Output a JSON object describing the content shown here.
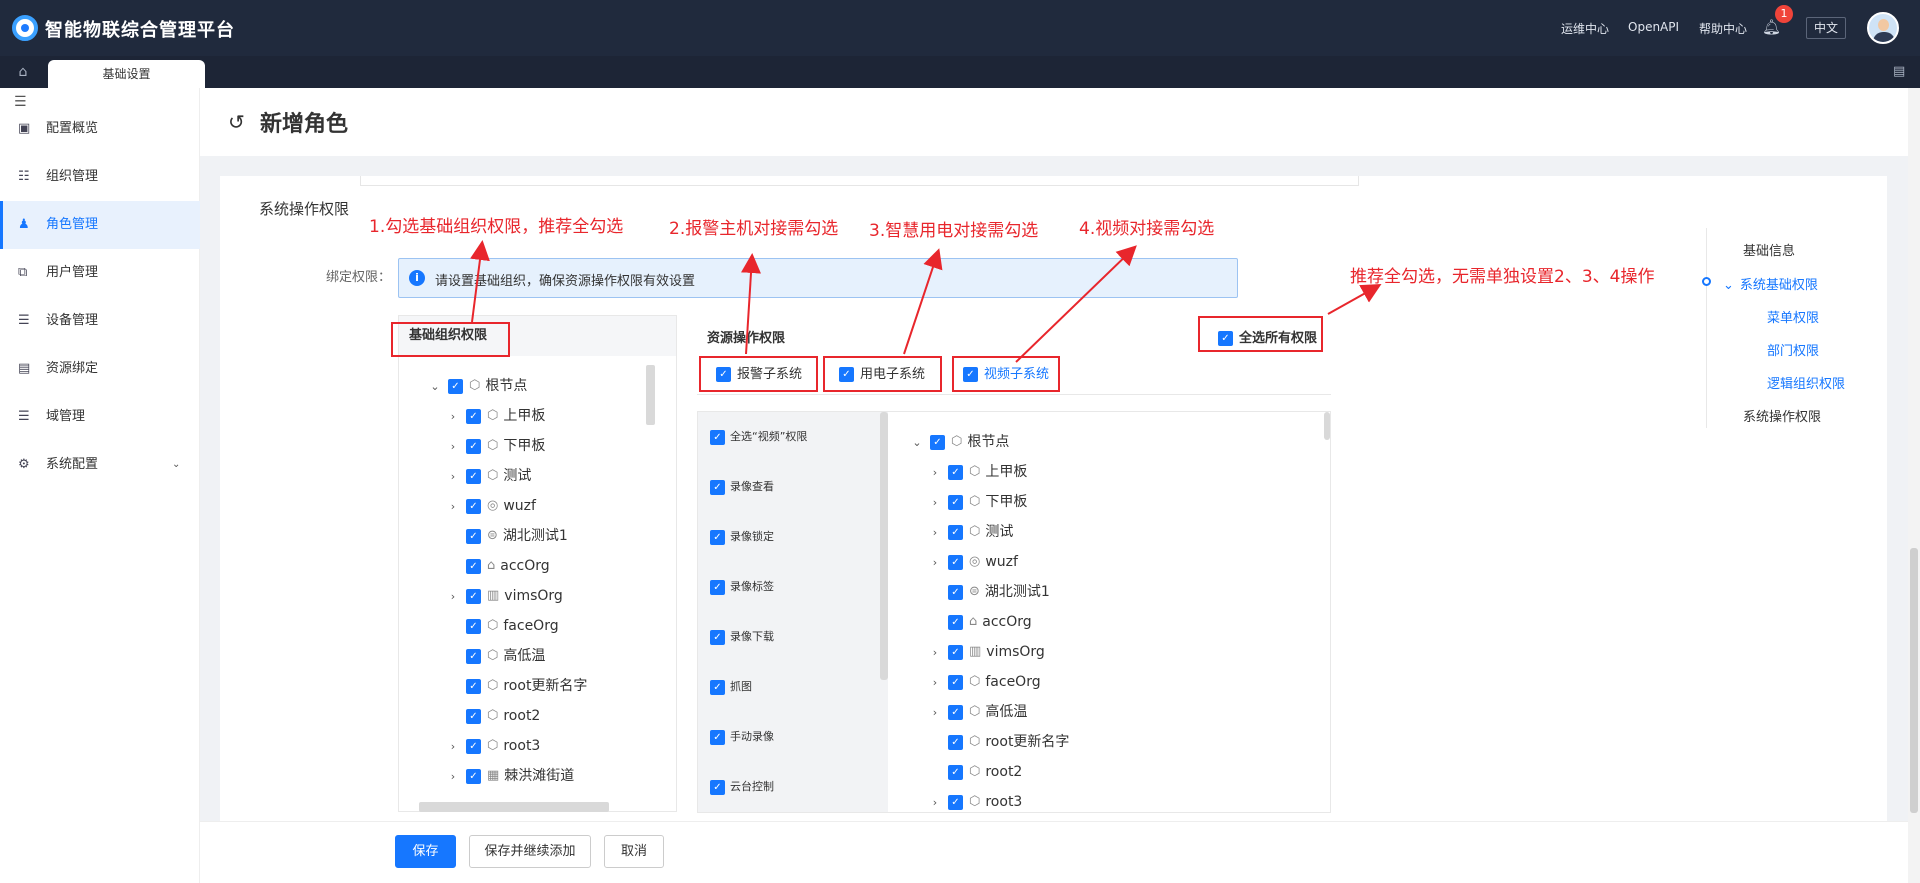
{
  "app": {
    "title": "智能物联综合管理平台"
  },
  "header": {
    "links": [
      "运维中心",
      "OpenAPI",
      "帮助中心"
    ],
    "notification_count": "1",
    "lang": "中文"
  },
  "tabs": {
    "active": "基础设置"
  },
  "sidebar": {
    "items": [
      {
        "label": "配置概览",
        "icon": "dashboard-icon",
        "glyph": "▣"
      },
      {
        "label": "组织管理",
        "icon": "org-icon",
        "glyph": "☷"
      },
      {
        "label": "角色管理",
        "icon": "role-icon",
        "glyph": "♟"
      },
      {
        "label": "用户管理",
        "icon": "user-icon",
        "glyph": "⧉"
      },
      {
        "label": "设备管理",
        "icon": "device-icon",
        "glyph": "☰"
      },
      {
        "label": "资源绑定",
        "icon": "resource-icon",
        "glyph": "▤"
      },
      {
        "label": "域管理",
        "icon": "domain-icon",
        "glyph": "☰"
      },
      {
        "label": "系统配置",
        "icon": "gear-icon",
        "glyph": "⚙"
      }
    ]
  },
  "page": {
    "title": "新增角色"
  },
  "section": {
    "title": "系统操作权限",
    "bind_label": "绑定权限：",
    "alert": "请设置基础组织，确保资源操作权限有效设置"
  },
  "org_panel": {
    "title": "基础组织权限",
    "tree": [
      {
        "label": "根节点",
        "level": 0,
        "expand": "down",
        "icon": "cube-icon"
      },
      {
        "label": "上甲板",
        "level": 1,
        "expand": "right",
        "icon": "cube-icon"
      },
      {
        "label": "下甲板",
        "level": 1,
        "expand": "right",
        "icon": "cube-icon"
      },
      {
        "label": "测试",
        "level": 1,
        "expand": "right",
        "icon": "cube-icon"
      },
      {
        "label": "wuzf",
        "level": 1,
        "expand": "right",
        "icon": "org-circle-icon"
      },
      {
        "label": "湖北测试1",
        "level": 1,
        "expand": "",
        "icon": "bank-icon"
      },
      {
        "label": "accOrg",
        "level": 1,
        "expand": "",
        "icon": "home-icon"
      },
      {
        "label": "vimsOrg",
        "level": 1,
        "expand": "right",
        "icon": "building-icon"
      },
      {
        "label": "faceOrg",
        "level": 1,
        "expand": "",
        "icon": "cube-icon"
      },
      {
        "label": "高低温",
        "level": 1,
        "expand": "",
        "icon": "cube-icon"
      },
      {
        "label": "root更新名字",
        "level": 1,
        "expand": "",
        "icon": "cube-icon"
      },
      {
        "label": "root2",
        "level": 1,
        "expand": "",
        "icon": "cube-icon"
      },
      {
        "label": "root3",
        "level": 1,
        "expand": "right",
        "icon": "cube-icon"
      },
      {
        "label": "棘洪滩街道",
        "level": 1,
        "expand": "right",
        "icon": "street-icon"
      }
    ]
  },
  "resource_panel": {
    "title": "资源操作权限",
    "select_all": "全选所有权限",
    "subtabs": [
      "报警子系统",
      "用电子系统",
      "视频子系统"
    ],
    "perms": [
      "全选“视频”权限",
      "录像查看",
      "录像锁定",
      "录像标签",
      "录像下载",
      "抓图",
      "手动录像",
      "云台控制"
    ],
    "tree": [
      {
        "label": "根节点",
        "level": 0,
        "expand": "down",
        "icon": "cube-icon"
      },
      {
        "label": "上甲板",
        "level": 1,
        "expand": "right",
        "icon": "cube-icon"
      },
      {
        "label": "下甲板",
        "level": 1,
        "expand": "right",
        "icon": "cube-icon"
      },
      {
        "label": "测试",
        "level": 1,
        "expand": "right",
        "icon": "cube-icon"
      },
      {
        "label": "wuzf",
        "level": 1,
        "expand": "right",
        "icon": "org-circle-icon"
      },
      {
        "label": "湖北测试1",
        "level": 1,
        "expand": "",
        "icon": "bank-icon"
      },
      {
        "label": "accOrg",
        "level": 1,
        "expand": "",
        "icon": "home-icon"
      },
      {
        "label": "vimsOrg",
        "level": 1,
        "expand": "right",
        "icon": "building-icon"
      },
      {
        "label": "faceOrg",
        "level": 1,
        "expand": "right",
        "icon": "cube-icon"
      },
      {
        "label": "高低温",
        "level": 1,
        "expand": "right",
        "icon": "cube-icon"
      },
      {
        "label": "root更新名字",
        "level": 1,
        "expand": "",
        "icon": "cube-icon"
      },
      {
        "label": "root2",
        "level": 1,
        "expand": "",
        "icon": "cube-icon"
      },
      {
        "label": "root3",
        "level": 1,
        "expand": "right",
        "icon": "cube-icon"
      }
    ]
  },
  "annotations": [
    "1.勾选基础组织权限，推荐全勾选",
    "2.报警主机对接需勾选",
    "3.智慧用电对接需勾选",
    "4.视频对接需勾选",
    "推荐全勾选，无需单独设置2、3、4操作"
  ],
  "anchor_nav": {
    "items": [
      "基础信息",
      "系统基础权限",
      "菜单权限",
      "部门权限",
      "逻辑组织权限",
      "系统操作权限"
    ]
  },
  "footer": {
    "save": "保存",
    "save_continue": "保存并继续添加",
    "cancel": "取消"
  },
  "colors": {
    "topbar": "#202a3d",
    "primary": "#1677ff",
    "annotation": "#e8262c"
  }
}
